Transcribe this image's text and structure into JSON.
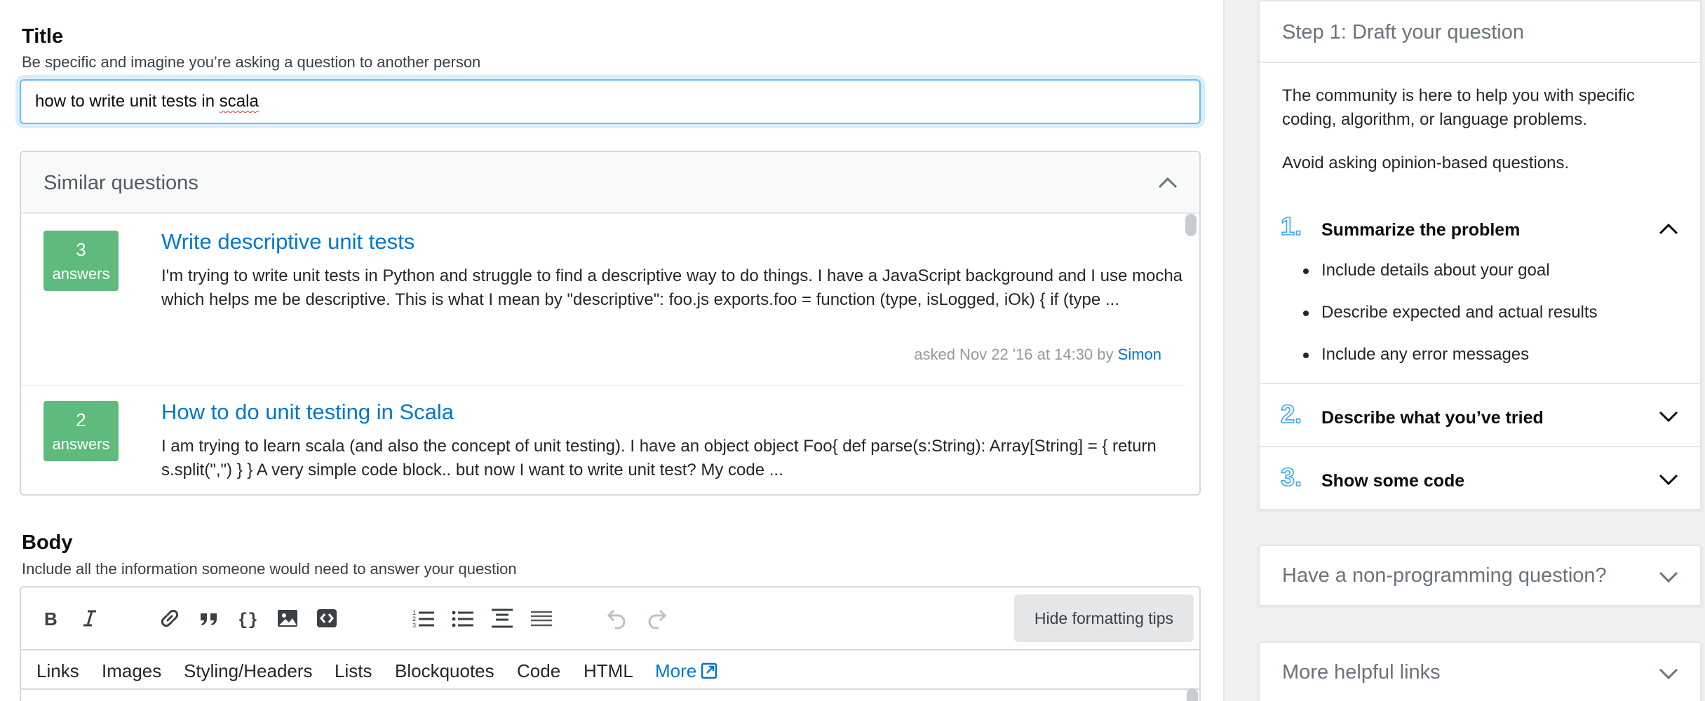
{
  "title_field": {
    "label": "Title",
    "description": "Be specific and imagine you’re asking a question to another person",
    "value_prefix": "how to write unit tests in ",
    "value_misspelled": "scala"
  },
  "similar": {
    "header": "Similar questions",
    "items": [
      {
        "count": "3",
        "count_label": "answers",
        "title": "Write descriptive unit tests",
        "excerpt": "I'm trying to write unit tests in Python and struggle to find a descriptive way to do things. I have a JavaScript background and I use mocha which helps me be descriptive. This is what I mean by \"descriptive\": foo.js exports.foo = function (type, isLogged, iOk) { if (type ...",
        "meta_prefix": "asked Nov 22 '16 at 14:30 by ",
        "user": "Simon"
      },
      {
        "count": "2",
        "count_label": "answers",
        "title": "How to do unit testing in Scala",
        "excerpt": "I am trying to learn scala (and also the concept of unit testing). I have an object object Foo{ def parse(s:String): Array[String] = { return s.split(\",\") } } A very simple code block.. but now I want to write unit test? My code ..."
      }
    ]
  },
  "body_field": {
    "label": "Body",
    "description": "Include all the information someone would need to answer your question"
  },
  "editor": {
    "toolbar_icons": [
      "bold-icon",
      "italic-icon",
      "link-icon",
      "blockquote-icon",
      "code-icon",
      "image-icon",
      "snippet-icon",
      "ordered-list-icon",
      "unordered-list-icon",
      "heading-icon",
      "horizontal-rule-icon",
      "undo-icon",
      "redo-icon"
    ],
    "hide_tips_label": "Hide formatting tips",
    "tips": [
      "Links",
      "Images",
      "Styling/Headers",
      "Lists",
      "Blockquotes",
      "Code",
      "HTML"
    ],
    "more_label": "More"
  },
  "sidebar": {
    "step_card": {
      "header": "Step 1: Draft your question",
      "intro_1": "The community is here to help you with specific coding, algorithm, or language problems.",
      "intro_2": "Avoid asking opinion-based questions.",
      "steps": [
        {
          "number": "1.",
          "title": "Summarize the problem",
          "expanded": true,
          "bullets": [
            "Include details about your goal",
            "Describe expected and actual results",
            "Include any error messages"
          ]
        },
        {
          "number": "2.",
          "title": "Describe what you’ve tried",
          "expanded": false
        },
        {
          "number": "3.",
          "title": "Show some code",
          "expanded": false
        }
      ]
    },
    "non_programming": "Have a non-programming question?",
    "helpful_links": "More helpful links"
  },
  "colors": {
    "accent_blue": "#0077cc",
    "answered_green": "#5eba7d",
    "step_number_blue": "#39a9f4",
    "focus_ring": "#6cbbf7"
  }
}
